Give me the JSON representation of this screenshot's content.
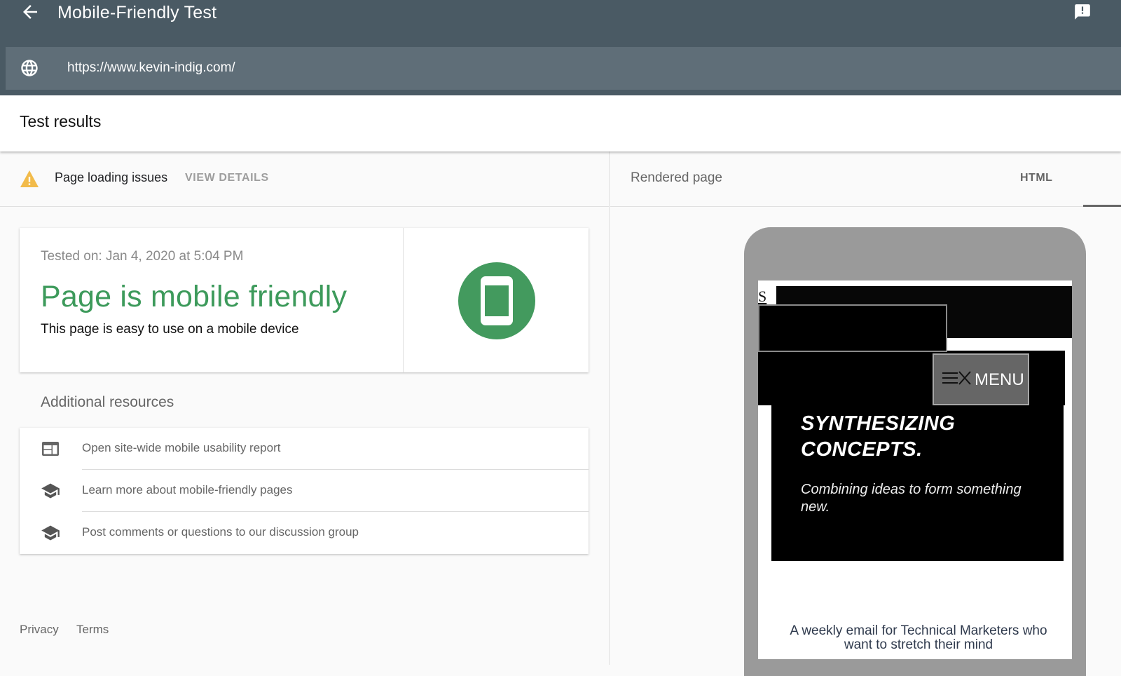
{
  "appbar": {
    "title": "Mobile-Friendly Test",
    "back_icon": "arrow-back-icon",
    "feedback_icon": "feedback-icon"
  },
  "url_bar": {
    "icon": "globe-icon",
    "value": "https://www.kevin-indig.com/"
  },
  "results": {
    "title": "Test results"
  },
  "issues": {
    "icon": "warning-icon",
    "label": "Page loading issues",
    "action": "VIEW DETAILS"
  },
  "result_card": {
    "tested_on": "Tested on: Jan 4, 2020 at 5:04 PM",
    "verdict": "Page is mobile friendly",
    "verdict_subtitle": "This page is easy to use on a mobile device",
    "status_color": "#3d9a5b",
    "icon": "smartphone-icon"
  },
  "additional_resources": {
    "title": "Additional resources",
    "items": [
      {
        "icon": "web-layout-icon",
        "label": "Open site-wide mobile usability report"
      },
      {
        "icon": "school-icon",
        "label": "Learn more about mobile-friendly pages"
      },
      {
        "icon": "school-icon",
        "label": "Post comments or questions to our discussion group"
      }
    ]
  },
  "footer": {
    "privacy": "Privacy",
    "terms": "Terms"
  },
  "right_panel": {
    "label": "Rendered page",
    "tab_html": "HTML"
  },
  "rendered_site": {
    "skip_link": "S",
    "menu_label": "MENU",
    "hero_title_line1": "SYNTHESIZING",
    "hero_title_line2": "CONCEPTS.",
    "hero_subtitle": "Combining ideas to form something new.",
    "newsletter_line1": "A weekly email for Technical Marketers who",
    "newsletter_line2": "want to stretch their mind"
  }
}
